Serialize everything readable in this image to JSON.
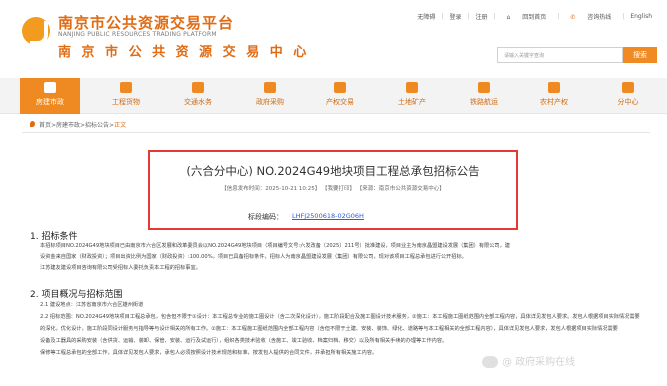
{
  "header": {
    "brand_cn": "南京市公共资源交易平台",
    "brand_en": "NANJING PUBLIC RESOURCES TRADING PLATFORM",
    "brand_cn_2": "南 京 市 公 共 资 源 交 易 中 心",
    "links": [
      "无障碍",
      "登录",
      "注册",
      "回到首页",
      "咨询热线",
      "English"
    ],
    "search_placeholder": "请输入关键字查询",
    "search_button": "搜索"
  },
  "nav": {
    "items": [
      {
        "label": "房建市政",
        "icon": "building-icon"
      },
      {
        "label": "工程货物",
        "icon": "crane-icon"
      },
      {
        "label": "交通水务",
        "icon": "bus-icon"
      },
      {
        "label": "政府采购",
        "icon": "cart-icon"
      },
      {
        "label": "产权交易",
        "icon": "house-icon"
      },
      {
        "label": "土地矿产",
        "icon": "land-icon"
      },
      {
        "label": "铁路航运",
        "icon": "plane-icon"
      },
      {
        "label": "农村产权",
        "icon": "farm-icon"
      },
      {
        "label": "分中心",
        "icon": "pin-icon"
      }
    ],
    "active_index": 0
  },
  "breadcrumb": {
    "path": "首页>房建市政>招标公告>",
    "current": "正文"
  },
  "notice": {
    "title": "(六合分中心) NO.2024G49地块项目工程总承包招标公告",
    "meta": "【信息发布时间：2025-10-21 10:25】 【我要打印】 【来源：南京市公共资源交易中心】",
    "bid_label": "标段编码：",
    "bid_code": "LHFJ2500618-02G06H"
  },
  "section1": {
    "heading": "1. 招标条件",
    "line1": "本招标项目NO.2024G49地块项目已由南京市六合区发展和改革委员会以NO.2024G49地块项目（项目编号文号:六发改备〔2025〕211号）批准建设，项目业主为南京晶盟建设发展（集团）有限公司，建",
    "line2": "设资金来自国家（财政投资）；项目出资比例为国家（财政投资）:100.00%，项目已具备招标条件，招标人为南京晶盟建设发展（集团）有限公司，现对该项目工程总承包进行公开招标。",
    "line3": "江苏建友建设项目咨询有限公司受招标人委托负责本工程的招标事宜。"
  },
  "section2": {
    "heading": "2. 项目概况与招标范围",
    "line1": "2.1 建设地点：江苏省南京市六合区雄州街道",
    "line2": "2.2 招标范围：NO.2024G49地块项目工程总承包，包含但不限于①设计：本工程总专业的施工图设计（含二次深化设计），施工阶段配合及施工图设计技术服务，②施工：本工程施工图纸范围内全部工程内容，具体详见发包人要求。发包人根据项目实际情况需要",
    "line3": "的深化，优化设计，施工阶段同设计服务与指导等与设计相关的所有工作。②施工：本工程施工图纸范围内全部工程内容（含但不限于土建、安装、装饰、绿化、道路等与本工程相关的全部工程内容），具体详见发包人要求，发包人根据项目实际情况需要",
    "line4": "设备及工器具的采购安装（含供货、运输、装卸、保管、安装、运行及试运行），组织各类技术验收（含施工、竣工验收、档案归档、移交）以及所有相关手续的办理等工作内容。",
    "line5": "保修等工程总承包的全部工作，具体详见发包人要求，承包人必须按照设计技术规范和标准，按发包人提供的合同文件，并承担所有相关施工内容。"
  },
  "watermark": "@ 政府采购在线"
}
